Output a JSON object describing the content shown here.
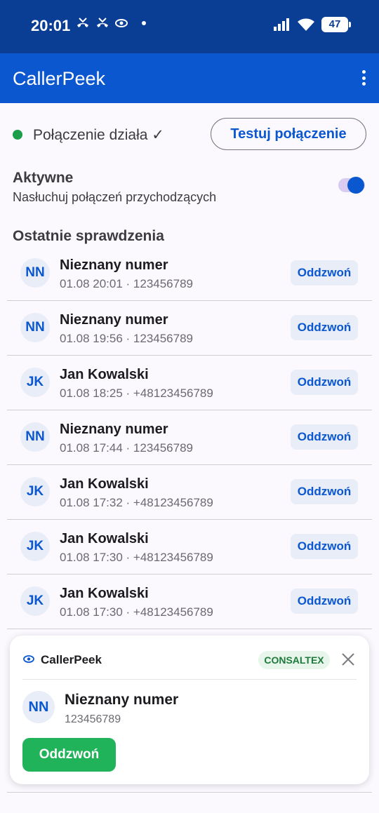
{
  "status_bar": {
    "time": "20:01",
    "battery": "47"
  },
  "app_bar": {
    "title": "CallerPeek"
  },
  "connection": {
    "status_text": "Połączenie działa ✓",
    "test_button": "Testuj połączenie"
  },
  "active": {
    "title": "Aktywne",
    "subtitle": "Nasłuchuj połączeń przychodzących",
    "enabled": true
  },
  "recent": {
    "title": "Ostatnie sprawdzenia",
    "items": [
      {
        "initials": "NN",
        "name": "Nieznany numer",
        "meta": "01.08 20:01 · 123456789",
        "action": "Oddzwoń"
      },
      {
        "initials": "NN",
        "name": "Nieznany numer",
        "meta": "01.08 19:56 · 123456789",
        "action": "Oddzwoń"
      },
      {
        "initials": "JK",
        "name": "Jan Kowalski",
        "meta": "01.08 18:25 · +48123456789",
        "action": "Oddzwoń"
      },
      {
        "initials": "NN",
        "name": "Nieznany numer",
        "meta": "01.08 17:44 · 123456789",
        "action": "Oddzwoń"
      },
      {
        "initials": "JK",
        "name": "Jan Kowalski",
        "meta": "01.08 17:32 · +48123456789",
        "action": "Oddzwoń"
      },
      {
        "initials": "JK",
        "name": "Jan Kowalski",
        "meta": "01.08 17:30 · +48123456789",
        "action": "Oddzwoń"
      },
      {
        "initials": "JK",
        "name": "Jan Kowalski",
        "meta": "01.08 17:30 · +48123456789",
        "action": "Oddzwoń"
      }
    ]
  },
  "notification": {
    "app_name": "CallerPeek",
    "tag": "CONSALTEX",
    "initials": "NN",
    "name": "Nieznany numer",
    "number": "123456789",
    "action": "Oddzwoń"
  }
}
